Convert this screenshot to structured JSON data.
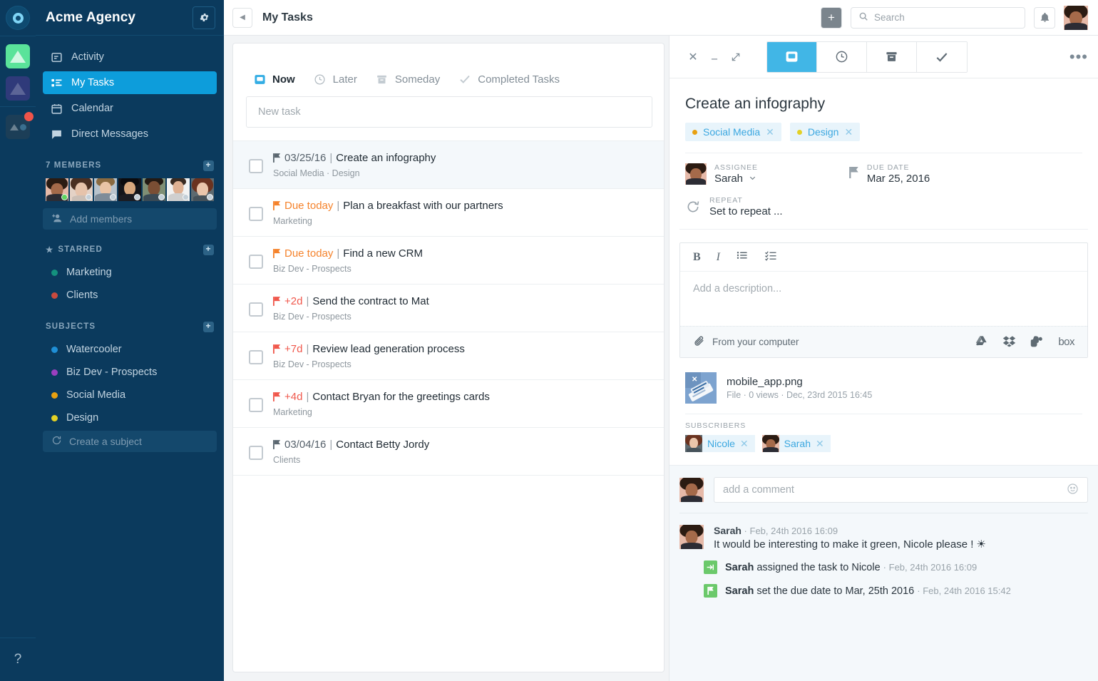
{
  "rail": {
    "logo": "app-logo",
    "apps": [
      {
        "name": "workspace-green",
        "color": "#5ae39a"
      },
      {
        "name": "workspace-indigo",
        "color": "#2f3a7a"
      },
      {
        "name": "workspace-dark",
        "color": "#1c3e57",
        "badge": true
      }
    ],
    "help_label": "?"
  },
  "sidebar": {
    "title": "Acme Agency",
    "settings_icon": "gear-icon",
    "nav": [
      {
        "label": "Activity",
        "icon": "activity-icon",
        "active": false
      },
      {
        "label": "My Tasks",
        "icon": "tasks-icon",
        "active": true
      },
      {
        "label": "Calendar",
        "icon": "calendar-icon",
        "active": false
      },
      {
        "label": "Direct Messages",
        "icon": "chat-icon",
        "active": false
      }
    ],
    "members": {
      "header": "7 MEMBERS",
      "add_label": "Add members",
      "add_icon": "add-person-icon",
      "count": 7
    },
    "starred": {
      "header": "STARRED",
      "items": [
        {
          "label": "Marketing",
          "color": "#14917e"
        },
        {
          "label": "Clients",
          "color": "#c94a3e"
        }
      ]
    },
    "subjects": {
      "header": "SUBJECTS",
      "items": [
        {
          "label": "Watercooler",
          "color": "#1f8fd6"
        },
        {
          "label": "Biz Dev - Prospects",
          "color": "#9b3fbf"
        },
        {
          "label": "Social Media",
          "color": "#e8a010"
        },
        {
          "label": "Design",
          "color": "#e3d125"
        }
      ],
      "create_label": "Create a subject",
      "create_icon": "refresh-icon"
    }
  },
  "topbar": {
    "collapse_icon": "chevron-left-icon",
    "page_title": "My Tasks",
    "add_icon": "plus-icon",
    "search_placeholder": "Search",
    "search_icon": "search-icon",
    "bell_icon": "bell-icon",
    "avatar": "user-avatar"
  },
  "tasklist": {
    "tabs": [
      {
        "label": "Now",
        "icon": "inbox-icon",
        "active": true
      },
      {
        "label": "Later",
        "icon": "clock-icon",
        "active": false
      },
      {
        "label": "Someday",
        "icon": "archive-icon",
        "active": false
      },
      {
        "label": "Completed Tasks",
        "icon": "check-icon",
        "active": false
      }
    ],
    "new_task_placeholder": "New task",
    "rows": [
      {
        "due": "03/25/16",
        "due_style": "grey",
        "title": "Create an infography",
        "subject": "Social Media · Design",
        "selected": true
      },
      {
        "due": "Due today",
        "due_style": "orange",
        "title": "Plan a breakfast with our partners",
        "subject": "Marketing",
        "selected": false
      },
      {
        "due": "Due today",
        "due_style": "orange",
        "title": "Find a new CRM",
        "subject": "Biz Dev - Prospects",
        "selected": false
      },
      {
        "due": "+2d",
        "due_style": "red",
        "title": "Send the contract to Mat",
        "subject": "Biz Dev - Prospects",
        "selected": false
      },
      {
        "due": "+7d",
        "due_style": "red",
        "title": "Review lead generation process",
        "subject": "Biz Dev - Prospects",
        "selected": false
      },
      {
        "due": "+4d",
        "due_style": "red",
        "title": "Contact Bryan for the greetings cards",
        "subject": "Marketing",
        "selected": false
      },
      {
        "due": "03/04/16",
        "due_style": "grey",
        "title": "Contact Betty Jordy",
        "subject": "Clients",
        "selected": false
      }
    ]
  },
  "detail": {
    "window_controls": [
      {
        "name": "close-icon",
        "glyph": "✕"
      },
      {
        "name": "minimize-icon",
        "glyph": "—"
      },
      {
        "name": "expand-icon",
        "glyph": "⤢"
      }
    ],
    "mode_tabs": [
      {
        "name": "tab-details",
        "icon": "inbox-icon",
        "active": true
      },
      {
        "name": "tab-later",
        "icon": "clock-icon",
        "active": false
      },
      {
        "name": "tab-archive",
        "icon": "archive-icon",
        "active": false
      },
      {
        "name": "tab-complete",
        "icon": "check-icon",
        "active": false
      }
    ],
    "more_icon": "ellipsis-icon",
    "title": "Create an infography",
    "chips": [
      {
        "label": "Social Media",
        "color": "#e8a010"
      },
      {
        "label": "Design",
        "color": "#e3d125"
      }
    ],
    "assignee": {
      "label": "ASSIGNEE",
      "value": "Sarah",
      "chevron": "chevron-down-icon"
    },
    "due_date": {
      "label": "DUE DATE",
      "value": "Mar 25, 2016",
      "icon": "flag-icon"
    },
    "repeat": {
      "label": "REPEAT",
      "value": "Set to repeat ...",
      "icon": "repeat-icon"
    },
    "editor": {
      "tools": [
        {
          "name": "bold-icon",
          "glyph": "B"
        },
        {
          "name": "italic-icon",
          "glyph": "I"
        },
        {
          "name": "bullet-list-icon",
          "glyph": "list"
        },
        {
          "name": "checklist-icon",
          "glyph": "checklist"
        }
      ],
      "placeholder": "Add a description...",
      "upload_label": "From your computer",
      "upload_icon": "paperclip-icon",
      "services": [
        "google-drive-icon",
        "dropbox-icon",
        "evernote-icon",
        "box-icon"
      ],
      "box_label": "box"
    },
    "file": {
      "name": "mobile_app.png",
      "meta": "File · 0 views · Dec, 23rd 2015 16:45",
      "thumb": "image-thumbnail"
    },
    "subscribers": {
      "label": "SUBSCRIBERS",
      "items": [
        {
          "name": "Nicole"
        },
        {
          "name": "Sarah"
        }
      ]
    },
    "comment": {
      "placeholder": "add a comment",
      "emoji_icon": "smiley-icon"
    },
    "activity": [
      {
        "type": "comment",
        "author": "Sarah",
        "time": "Feb, 24th 2016 16:09",
        "text": "It would be interesting to make it green, Nicole please ! ☀"
      },
      {
        "type": "event",
        "icon": "assign-icon",
        "author": "Sarah",
        "text": "assigned the task to Nicole",
        "time": "Feb, 24th 2016 16:09"
      },
      {
        "type": "event",
        "icon": "flag-icon",
        "author": "Sarah",
        "text": "set the due date to Mar, 25th 2016",
        "time": "Feb, 24th 2016 15:42"
      }
    ]
  },
  "colors": {
    "sidebar_bg": "#0b3a5d",
    "accent_blue": "#0d9ddb",
    "panel_accent": "#41b6e6",
    "orange_due": "#f5832c",
    "red_due": "#f0584c",
    "chip_bg": "#e8f4fb"
  }
}
